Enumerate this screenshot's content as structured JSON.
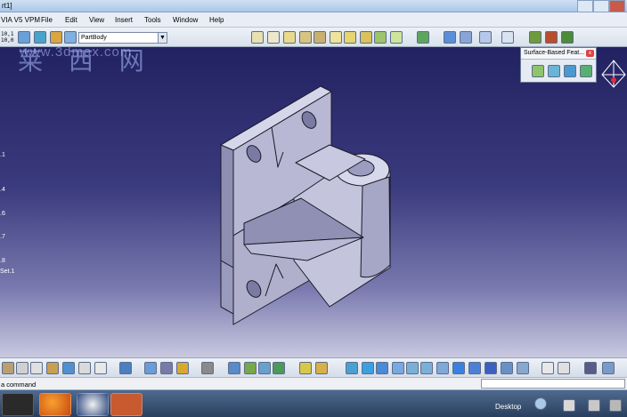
{
  "window": {
    "title_fragment": "rt1]"
  },
  "menubar": {
    "app_label": "VIA V5 VPM",
    "items": [
      "File",
      "Edit",
      "View",
      "Insert",
      "Tools",
      "Window",
      "Help"
    ]
  },
  "toolbar": {
    "scale_top": "10,1",
    "scale_bottom": "10,0",
    "current_body": "PartBody"
  },
  "tree": {
    "labels": [
      ".1",
      ".4",
      ".6",
      ".7",
      ".8",
      "Set.1"
    ]
  },
  "floating_toolbar": {
    "title": "Surface-Based Feat..."
  },
  "status": {
    "prompt": "a command",
    "command_value": ""
  },
  "taskbar": {
    "desktop_label": "Desktop"
  },
  "watermark": {
    "glyphs": "莱 西 网",
    "url": "www.3dmax.com"
  },
  "colors": {
    "viewport_top": "#222262",
    "viewport_bottom": "#c9c9e0",
    "part_face": "#b2b2d0"
  }
}
